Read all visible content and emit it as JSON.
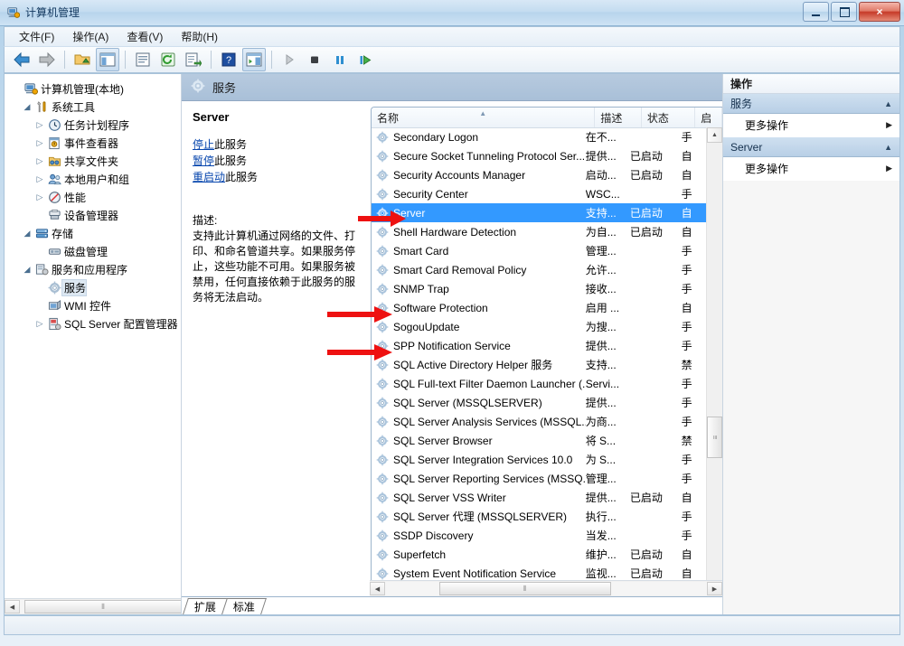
{
  "window": {
    "title": "计算机管理",
    "icon": "computer-management-icon",
    "minimize_label": "最小化",
    "maximize_label": "最大化",
    "close_label": "×"
  },
  "menubar": {
    "items": [
      {
        "label": "文件(F)",
        "name": "menu-file"
      },
      {
        "label": "操作(A)",
        "name": "menu-action"
      },
      {
        "label": "查看(V)",
        "name": "menu-view"
      },
      {
        "label": "帮助(H)",
        "name": "menu-help"
      }
    ]
  },
  "toolbar": {
    "buttons": [
      {
        "name": "back-icon",
        "glyph": "←"
      },
      {
        "name": "forward-icon",
        "glyph": "→"
      },
      {
        "name": "up-folder-icon",
        "glyph": "📂"
      },
      {
        "name": "show-hide-tree-icon",
        "glyph": "▤"
      },
      {
        "name": "properties-icon",
        "glyph": "▣"
      },
      {
        "name": "refresh-icon",
        "glyph": "↻"
      },
      {
        "name": "export-list-icon",
        "glyph": "⇥"
      },
      {
        "name": "help-icon",
        "glyph": "?"
      },
      {
        "name": "show-action-pane-icon",
        "glyph": "▥"
      },
      {
        "name": "start-service-icon",
        "glyph": "▶"
      },
      {
        "name": "stop-service-icon",
        "glyph": "■"
      },
      {
        "name": "pause-service-icon",
        "glyph": "❚❚"
      },
      {
        "name": "restart-service-icon",
        "glyph": "▐▶"
      }
    ]
  },
  "tree": {
    "items": [
      {
        "label": "计算机管理(本地)",
        "depth": 0,
        "expander": "",
        "icon": "computer-icon",
        "selected": false
      },
      {
        "label": "系统工具",
        "depth": 1,
        "expander": "open",
        "icon": "tools-icon",
        "selected": false
      },
      {
        "label": "任务计划程序",
        "depth": 2,
        "expander": "closed",
        "icon": "clock-icon",
        "selected": false
      },
      {
        "label": "事件查看器",
        "depth": 2,
        "expander": "closed",
        "icon": "event-viewer-icon",
        "selected": false
      },
      {
        "label": "共享文件夹",
        "depth": 2,
        "expander": "closed",
        "icon": "shared-folder-icon",
        "selected": false
      },
      {
        "label": "本地用户和组",
        "depth": 2,
        "expander": "closed",
        "icon": "users-icon",
        "selected": false
      },
      {
        "label": "性能",
        "depth": 2,
        "expander": "closed",
        "icon": "performance-icon",
        "selected": false
      },
      {
        "label": "设备管理器",
        "depth": 2,
        "expander": "",
        "icon": "device-manager-icon",
        "selected": false
      },
      {
        "label": "存储",
        "depth": 1,
        "expander": "open",
        "icon": "storage-icon",
        "selected": false
      },
      {
        "label": "磁盘管理",
        "depth": 2,
        "expander": "",
        "icon": "disk-management-icon",
        "selected": false
      },
      {
        "label": "服务和应用程序",
        "depth": 1,
        "expander": "open",
        "icon": "services-apps-icon",
        "selected": false
      },
      {
        "label": "服务",
        "depth": 2,
        "expander": "",
        "icon": "service-gear-icon",
        "selected": true
      },
      {
        "label": "WMI 控件",
        "depth": 2,
        "expander": "",
        "icon": "wmi-icon",
        "selected": false
      },
      {
        "label": "SQL Server 配置管理器",
        "depth": 2,
        "expander": "closed",
        "icon": "sql-config-icon",
        "selected": false
      }
    ],
    "hscroll_grip": "⦀",
    "left_arrow": "◀",
    "right_arrow": "▶"
  },
  "mid": {
    "header_title": "服务",
    "header_icon": "service-gear-icon",
    "detail": {
      "title": "Server",
      "links": [
        {
          "link": "停止",
          "rest": "此服务",
          "name": "stop-service-link"
        },
        {
          "link": "暂停",
          "rest": "此服务",
          "name": "pause-service-link"
        },
        {
          "link": "重启动",
          "rest": "此服务",
          "name": "restart-service-link"
        }
      ],
      "desc_label": "描述:",
      "desc_text": "支持此计算机通过网络的文件、打印、和命名管道共享。如果服务停止，这些功能不可用。如果服务被禁用，任何直接依赖于此服务的服务将无法启动。"
    },
    "tabs": [
      {
        "label": "扩展",
        "name": "tab-extended",
        "active": false
      },
      {
        "label": "标准",
        "name": "tab-standard",
        "active": true
      }
    ]
  },
  "list": {
    "columns": [
      {
        "label": "名称",
        "name": "column-name",
        "sorted": true
      },
      {
        "label": "描述",
        "name": "column-description",
        "sorted": false
      },
      {
        "label": "状态",
        "name": "column-status",
        "sorted": false
      },
      {
        "label": "启",
        "name": "column-startup-type",
        "sorted": false
      }
    ],
    "sort_caret": "▲",
    "rows": [
      {
        "name": "Secondary Logon",
        "desc": "在不...",
        "status": "",
        "start": "手",
        "selected": false,
        "arrow": false
      },
      {
        "name": "Secure Socket Tunneling Protocol Ser...",
        "desc": "提供...",
        "status": "已启动",
        "start": "自",
        "selected": false,
        "arrow": false
      },
      {
        "name": "Security Accounts Manager",
        "desc": "启动...",
        "status": "已启动",
        "start": "自",
        "selected": false,
        "arrow": false
      },
      {
        "name": "Security Center",
        "desc": "WSC...",
        "status": "",
        "start": "手",
        "selected": false,
        "arrow": false
      },
      {
        "name": "Server",
        "desc": "支持...",
        "status": "已启动",
        "start": "自",
        "selected": true,
        "arrow": true
      },
      {
        "name": "Shell Hardware Detection",
        "desc": "为自...",
        "status": "已启动",
        "start": "自",
        "selected": false,
        "arrow": false
      },
      {
        "name": "Smart Card",
        "desc": "管理...",
        "status": "",
        "start": "手",
        "selected": false,
        "arrow": false
      },
      {
        "name": "Smart Card Removal Policy",
        "desc": "允许...",
        "status": "",
        "start": "手",
        "selected": false,
        "arrow": false
      },
      {
        "name": "SNMP Trap",
        "desc": "接收...",
        "status": "",
        "start": "手",
        "selected": false,
        "arrow": false
      },
      {
        "name": "Software Protection",
        "desc": "启用 ...",
        "status": "",
        "start": "自",
        "selected": false,
        "arrow": true
      },
      {
        "name": "SogouUpdate",
        "desc": "为搜...",
        "status": "",
        "start": "手",
        "selected": false,
        "arrow": false
      },
      {
        "name": "SPP Notification Service",
        "desc": "提供...",
        "status": "",
        "start": "手",
        "selected": false,
        "arrow": true
      },
      {
        "name": "SQL Active Directory Helper 服务",
        "desc": "支持...",
        "status": "",
        "start": "禁",
        "selected": false,
        "arrow": false
      },
      {
        "name": "SQL Full-text Filter Daemon Launcher (...",
        "desc": "Servi...",
        "status": "",
        "start": "手",
        "selected": false,
        "arrow": false
      },
      {
        "name": "SQL Server (MSSQLSERVER)",
        "desc": "提供...",
        "status": "",
        "start": "手",
        "selected": false,
        "arrow": false
      },
      {
        "name": "SQL Server Analysis Services (MSSQL...",
        "desc": "为商...",
        "status": "",
        "start": "手",
        "selected": false,
        "arrow": false
      },
      {
        "name": "SQL Server Browser",
        "desc": "将 S...",
        "status": "",
        "start": "禁",
        "selected": false,
        "arrow": false
      },
      {
        "name": "SQL Server Integration Services 10.0",
        "desc": "为 S...",
        "status": "",
        "start": "手",
        "selected": false,
        "arrow": false
      },
      {
        "name": "SQL Server Reporting Services (MSSQ...",
        "desc": "管理...",
        "status": "",
        "start": "手",
        "selected": false,
        "arrow": false
      },
      {
        "name": "SQL Server VSS Writer",
        "desc": "提供...",
        "status": "已启动",
        "start": "自",
        "selected": false,
        "arrow": false
      },
      {
        "name": "SQL Server 代理 (MSSQLSERVER)",
        "desc": "执行...",
        "status": "",
        "start": "手",
        "selected": false,
        "arrow": false
      },
      {
        "name": "SSDP Discovery",
        "desc": "当发...",
        "status": "",
        "start": "手",
        "selected": false,
        "arrow": false
      },
      {
        "name": "Superfetch",
        "desc": "维护...",
        "status": "已启动",
        "start": "自",
        "selected": false,
        "arrow": false
      },
      {
        "name": "System Event Notification Service",
        "desc": "监视...",
        "status": "已启动",
        "start": "自",
        "selected": false,
        "arrow": false
      }
    ],
    "vscroll": {
      "up": "▲",
      "down": "▼",
      "grip": "≡"
    },
    "hscroll": {
      "left": "◀",
      "right": "▶",
      "grip": "⦀"
    }
  },
  "actions": {
    "title": "操作",
    "groups": [
      {
        "name": "服务",
        "collapse_glyph": "▲",
        "items": [
          {
            "label": "更多操作",
            "arrow": "▶",
            "name": "more-actions-services"
          }
        ]
      },
      {
        "name": "Server",
        "collapse_glyph": "▲",
        "items": [
          {
            "label": "更多操作",
            "arrow": "▶",
            "name": "more-actions-server"
          }
        ]
      }
    ]
  },
  "colors": {
    "selection": "#3399ff",
    "link": "#0645ad",
    "annotation_arrow": "#ee1111",
    "header_band": "#b7cadf"
  }
}
